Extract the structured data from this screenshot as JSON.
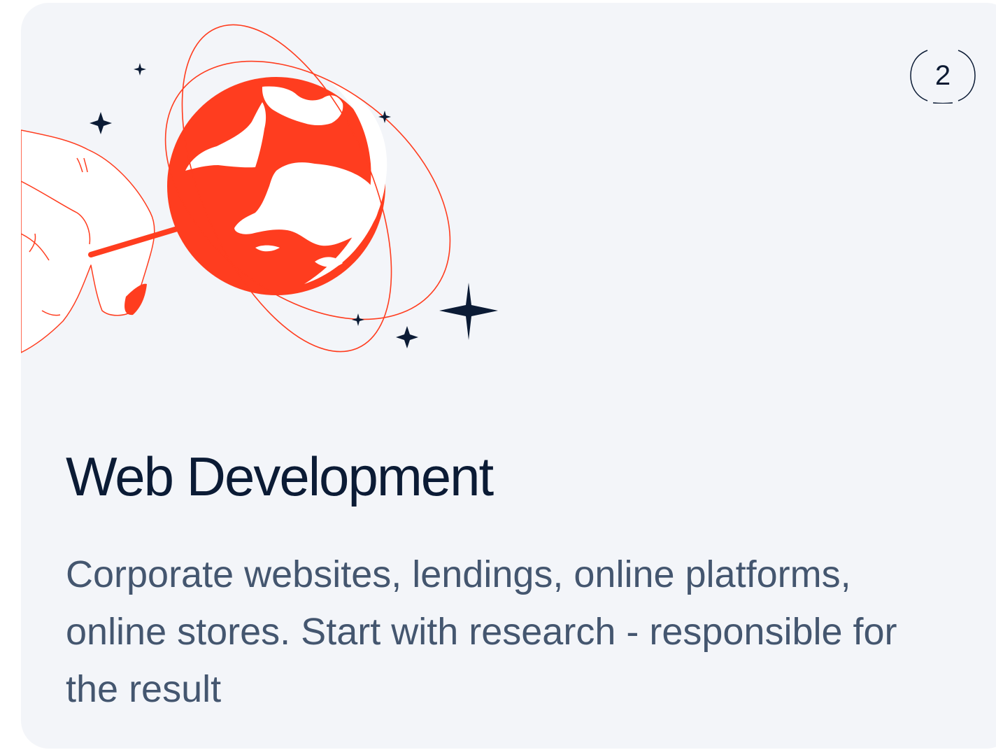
{
  "card": {
    "index": "2",
    "title": "Web Development",
    "description": "Corporate websites, lendings, online platforms, online stores. Start with research - responsible for the result"
  },
  "illustration": {
    "subject": "hand-holding-globe",
    "globe_color": "#ff3d1f",
    "star_color": "#0b1b35"
  },
  "colors": {
    "card_background": "#f3f5f9",
    "title": "#0b1b35",
    "description": "#44566f"
  }
}
